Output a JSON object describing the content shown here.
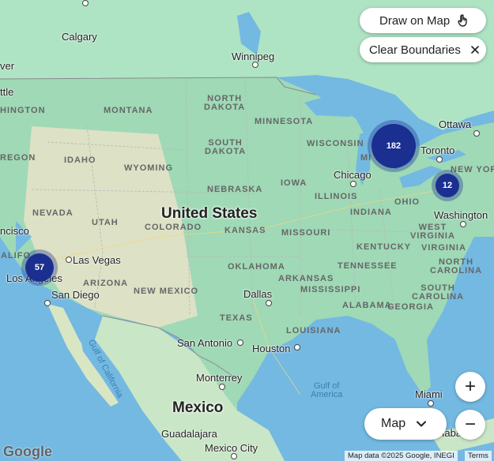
{
  "controls": {
    "draw_label": "Draw on Map",
    "clear_label": "Clear Boundaries",
    "map_type_label": "Map",
    "zoom_in": "+",
    "zoom_out": "−"
  },
  "clusters": [
    {
      "count": "182"
    },
    {
      "count": "57"
    },
    {
      "count": "12"
    }
  ],
  "labels": {
    "calgary": "Calgary",
    "winnipeg": "Winnipeg",
    "ottawa": "Ottawa",
    "toronto": "Toronto",
    "chicago": "Chicago",
    "washington": "Washington",
    "new_york": "NEW YORK",
    "united_states": "United States",
    "mexico": "Mexico",
    "las_vegas": "Las Vegas",
    "los_angeles": "Los Angeles",
    "san_diego": "San Diego",
    "dallas": "Dallas",
    "houston": "Houston",
    "san_antonio": "San Antonio",
    "monterrey": "Monterrey",
    "guadalajara": "Guadalajara",
    "mexico_city": "Mexico City",
    "miami": "Miami",
    "havana": "Haba",
    "francisco": "ncisco",
    "seattle": "ttle",
    "vancouver": "ver",
    "north_dakota": "NORTH\nDAKOTA",
    "south_dakota": "SOUTH\nDAKOTA",
    "montana": "MONTANA",
    "idaho": "IDAHO",
    "oregon": "REGON",
    "wyoming": "WYOMING",
    "nevada": "NEVADA",
    "utah": "UTAH",
    "colorado": "COLORADO",
    "california": "ALIFO",
    "arizona": "ARIZONA",
    "new_mexico": "NEW MEXICO",
    "nebraska": "NEBRASKA",
    "kansas": "KANSAS",
    "oklahoma": "OKLAHOMA",
    "texas": "TEXAS",
    "minnesota": "MINNESOTA",
    "iowa": "IOWA",
    "missouri": "MISSOURI",
    "arkansas": "ARKANSAS",
    "louisiana": "LOUISIANA",
    "wisconsin": "WISCONSIN",
    "illinois": "ILLINOIS",
    "indiana": "INDIANA",
    "ohio": "OHIO",
    "kentucky": "KENTUCKY",
    "tennessee": "TENNESSEE",
    "mississippi": "MISSISSIPPI",
    "alabama": "ALABAMA",
    "georgia": "GEORGIA",
    "west_virginia": "WEST\nVIRGINIA",
    "virginia": "VIRGINIA",
    "north_carolina": "NORTH\nCAROLINA",
    "south_carolina": "SOUTH\nCAROLINA",
    "michigan": "MI",
    "washington_state": "HINGTON",
    "gulf_of_california": "Gulf of California",
    "gulf_of_america": "Gulf of\nAmerica"
  },
  "attribution": {
    "logo": "Google",
    "map_data": "Map data ©2025 Google, INEGI",
    "terms": "Terms"
  }
}
